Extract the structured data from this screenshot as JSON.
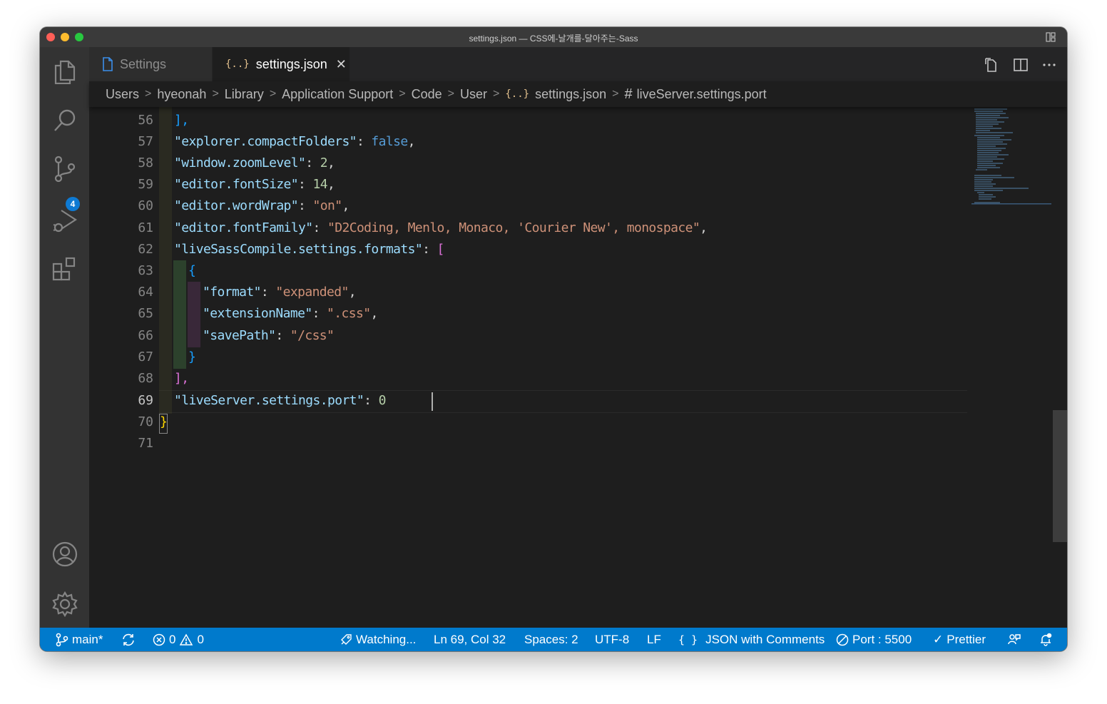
{
  "window": {
    "title": "settings.json — CSS에-날개를-달아주는-Sass"
  },
  "activity_bar": {
    "source_control_badge": "4"
  },
  "tabs": [
    {
      "label": "Settings",
      "active": false
    },
    {
      "label": "settings.json",
      "active": true
    }
  ],
  "breadcrumbs": {
    "items": [
      "Users",
      "hyeonah",
      "Library",
      "Application Support",
      "Code",
      "User"
    ],
    "file": "settings.json",
    "symbol": "liveServer.settings.port"
  },
  "editor": {
    "line_numbers": [
      "56",
      "57",
      "58",
      "59",
      "60",
      "61",
      "62",
      "63",
      "64",
      "65",
      "66",
      "67",
      "68",
      "69",
      "70",
      "71"
    ],
    "current_line": "69",
    "lines": {
      "l56": "],",
      "l57": [
        "\"explorer.compactFolders\"",
        ": ",
        "false",
        ","
      ],
      "l58": [
        "\"window.zoomLevel\"",
        ": ",
        "2",
        ","
      ],
      "l59": [
        "\"editor.fontSize\"",
        ": ",
        "14",
        ","
      ],
      "l60": [
        "\"editor.wordWrap\"",
        ": ",
        "\"on\"",
        ","
      ],
      "l61": [
        "\"editor.fontFamily\"",
        ": ",
        "\"D2Coding, Menlo, Monaco, 'Courier New', monospace\"",
        ","
      ],
      "l62": [
        "\"liveSassCompile.settings.formats\"",
        ": ",
        "["
      ],
      "l63": "{",
      "l64": [
        "\"format\"",
        ": ",
        "\"expanded\"",
        ","
      ],
      "l65": [
        "\"extensionName\"",
        ": ",
        "\".css\"",
        ","
      ],
      "l66": [
        "\"savePath\"",
        ": ",
        "\"/css\""
      ],
      "l67": "}",
      "l68": "],",
      "l69": [
        "\"liveServer.settings.port\"",
        ": ",
        "0"
      ],
      "l70": "}"
    }
  },
  "status_bar": {
    "branch": "main*",
    "errors": "0",
    "warnings": "0",
    "watching": "Watching...",
    "position": "Ln 69, Col 32",
    "spaces": "Spaces: 2",
    "encoding": "UTF-8",
    "eol": "LF",
    "language": "JSON with Comments",
    "port": "Port : 5500",
    "prettier": "Prettier"
  },
  "colors": {
    "status_bar": "#007acc",
    "editor_bg": "#1e1e1e",
    "key": "#9cdcfe",
    "string": "#ce9178",
    "number": "#b5cea8",
    "boolean": "#569cd6"
  }
}
